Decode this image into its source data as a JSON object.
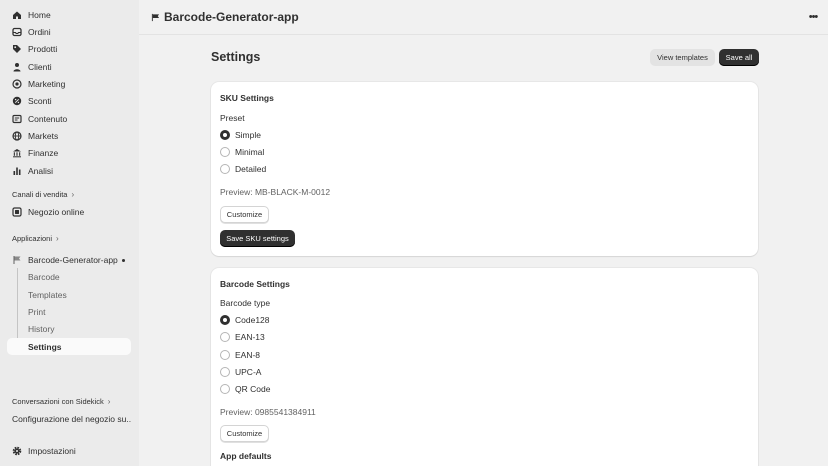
{
  "sidebar": {
    "nav": [
      {
        "label": "Home",
        "icon": "home-icon"
      },
      {
        "label": "Ordini",
        "icon": "orders-icon"
      },
      {
        "label": "Prodotti",
        "icon": "tag-icon"
      },
      {
        "label": "Clienti",
        "icon": "person-icon"
      },
      {
        "label": "Marketing",
        "icon": "target-icon"
      },
      {
        "label": "Sconti",
        "icon": "discount-icon"
      },
      {
        "label": "Contenuto",
        "icon": "content-icon"
      },
      {
        "label": "Markets",
        "icon": "globe-icon"
      },
      {
        "label": "Finanze",
        "icon": "bank-icon"
      },
      {
        "label": "Analisi",
        "icon": "chart-bar-icon"
      }
    ],
    "sales_channels_label": "Canali di vendita",
    "online_store_label": "Negozio online",
    "apps_label": "Applicazioni",
    "app_name": "Barcode-Generator-app",
    "app_subitems": [
      "Barcode",
      "Templates",
      "Print",
      "History",
      "Settings"
    ],
    "active_subitem": "Settings",
    "sidekick_label": "Conversazioni con Sidekick",
    "sidekick_item": "Configurazione del negozio su...",
    "settings_label": "Impostazioni"
  },
  "topbar": {
    "app_title": "Barcode-Generator-app",
    "more_label": "•••"
  },
  "page": {
    "title": "Settings",
    "view_templates_label": "View templates",
    "save_all_label": "Save all"
  },
  "sku_card": {
    "title": "SKU Settings",
    "preset_label": "Preset",
    "options": [
      "Simple",
      "Minimal",
      "Detailed"
    ],
    "selected": "Simple",
    "preview": "Preview: MB-BLACK-M-0012",
    "customize_label": "Customize",
    "save_label": "Save SKU settings"
  },
  "barcode_card": {
    "title": "Barcode Settings",
    "type_label": "Barcode type",
    "options": [
      "Code128",
      "EAN-13",
      "EAN-8",
      "UPC-A",
      "QR Code"
    ],
    "selected": "Code128",
    "preview": "Preview: 0985541384911",
    "customize_label": "Customize",
    "app_defaults_label": "App defaults"
  }
}
